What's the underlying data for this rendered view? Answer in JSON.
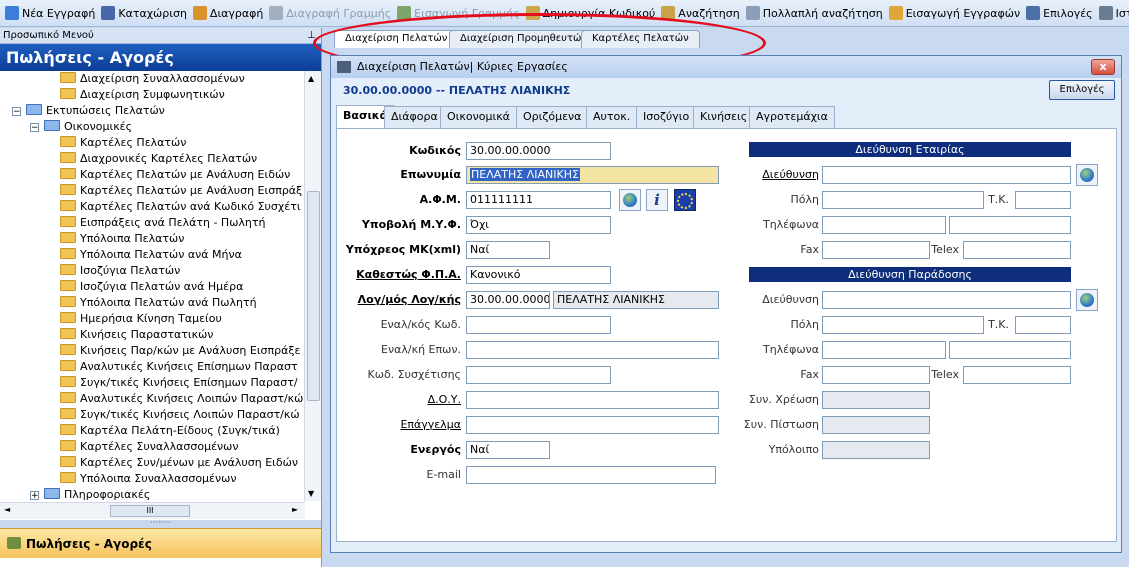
{
  "toolbar": {
    "items": [
      {
        "label": "Νέα Εγγραφή",
        "icon": "new-record-icon",
        "color": "#3b7dd8",
        "disabled": false
      },
      {
        "label": "Καταχώριση",
        "icon": "save-icon",
        "color": "#4867a8",
        "disabled": false
      },
      {
        "label": "Διαγραφή",
        "icon": "delete-icon",
        "color": "#d9922c",
        "disabled": false
      },
      {
        "label": "Διαγραφή Γραμμής",
        "icon": "delete-line-icon",
        "color": "#a3b0c2",
        "disabled": true
      },
      {
        "label": "Εισαγωγή Γραμμής",
        "icon": "insert-line-icon",
        "color": "#7fa66a",
        "disabled": true
      },
      {
        "label": "Δημιουργία Κωδικού",
        "icon": "create-code-icon",
        "color": "#c8a84a",
        "disabled": false
      },
      {
        "label": "Αναζήτηση",
        "icon": "search-icon",
        "color": "#c9a34a",
        "disabled": false
      },
      {
        "label": "Πολλαπλή αναζήτηση",
        "icon": "multi-search-icon",
        "color": "#8d9fb8",
        "disabled": false
      },
      {
        "label": "Εισαγωγή Εγγραφών",
        "icon": "import-records-icon",
        "color": "#e0a63a",
        "disabled": false
      },
      {
        "label": "Επιλογές",
        "icon": "options-icon",
        "color": "#4d6fa8",
        "disabled": false
      },
      {
        "label": "Ιστορικό",
        "icon": "history-icon",
        "color": "#6a7c93",
        "disabled": false
      }
    ]
  },
  "sidebar": {
    "caption": "Προσωπικό Μενού",
    "header": "Πωλήσεις - Αγορές",
    "tree": [
      {
        "label": "Διαχείριση Συναλλασσομένων",
        "level": 2,
        "blue": false,
        "toggle": ""
      },
      {
        "label": "Διαχείριση Συμφωνητικών",
        "level": 2,
        "blue": false,
        "toggle": ""
      },
      {
        "label": "Εκτυπώσεις Πελατών",
        "level": 0,
        "blue": true,
        "toggle": "−"
      },
      {
        "label": "Οικονομικές",
        "level": 1,
        "blue": true,
        "toggle": "−"
      },
      {
        "label": "Καρτέλες Πελατών",
        "level": 2,
        "blue": false,
        "toggle": ""
      },
      {
        "label": "Διαχρονικές Καρτέλες Πελατών",
        "level": 2,
        "blue": false,
        "toggle": ""
      },
      {
        "label": "Καρτέλες Πελατών με Ανάλυση Ειδών",
        "level": 2,
        "blue": false,
        "toggle": ""
      },
      {
        "label": "Καρτέλες Πελατών με Ανάλυση Εισπράξ",
        "level": 2,
        "blue": false,
        "toggle": ""
      },
      {
        "label": "Καρτέλες Πελατών ανά Κωδικό Συσχέτι",
        "level": 2,
        "blue": false,
        "toggle": ""
      },
      {
        "label": "Εισπράξεις ανά Πελάτη - Πωλητή",
        "level": 2,
        "blue": false,
        "toggle": ""
      },
      {
        "label": "Υπόλοιπα Πελατών",
        "level": 2,
        "blue": false,
        "toggle": ""
      },
      {
        "label": "Υπόλοιπα Πελατών ανά Μήνα",
        "level": 2,
        "blue": false,
        "toggle": ""
      },
      {
        "label": "Ισοζύγια Πελατών",
        "level": 2,
        "blue": false,
        "toggle": ""
      },
      {
        "label": "Ισοζύγια Πελατών ανά Ημέρα",
        "level": 2,
        "blue": false,
        "toggle": ""
      },
      {
        "label": "Υπόλοιπα Πελατών ανά Πωλητή",
        "level": 2,
        "blue": false,
        "toggle": ""
      },
      {
        "label": "Ημερήσια Κίνηση Ταμείου",
        "level": 2,
        "blue": false,
        "toggle": ""
      },
      {
        "label": "Κινήσεις Παραστατικών",
        "level": 2,
        "blue": false,
        "toggle": ""
      },
      {
        "label": "Κινήσεις Παρ/κών με Ανάλυση Εισπράξε",
        "level": 2,
        "blue": false,
        "toggle": ""
      },
      {
        "label": "Αναλυτικές Κινήσεις Επίσημων Παραστ",
        "level": 2,
        "blue": false,
        "toggle": ""
      },
      {
        "label": "Συγκ/τικές Κινήσεις Επίσημων Παραστ/",
        "level": 2,
        "blue": false,
        "toggle": ""
      },
      {
        "label": "Αναλυτικές Κινήσεις Λοιπών Παραστ/κώ",
        "level": 2,
        "blue": false,
        "toggle": ""
      },
      {
        "label": "Συγκ/τικές Κινήσεις Λοιπών Παραστ/κώ",
        "level": 2,
        "blue": false,
        "toggle": ""
      },
      {
        "label": "Καρτέλα Πελάτη-Είδους (Συγκ/τικά)",
        "level": 2,
        "blue": false,
        "toggle": ""
      },
      {
        "label": "Καρτέλες Συναλλασσομένων",
        "level": 2,
        "blue": false,
        "toggle": ""
      },
      {
        "label": "Καρτέλες Συν/μένων με Ανάλυση Ειδών",
        "level": 2,
        "blue": false,
        "toggle": ""
      },
      {
        "label": "Υπόλοιπα Συναλλασσομένων",
        "level": 2,
        "blue": false,
        "toggle": ""
      },
      {
        "label": "Πληροφοριακές",
        "level": 1,
        "blue": true,
        "toggle": "+"
      }
    ],
    "hscroll_thumb": "III",
    "footer": "Πωλήσεις - Αγορές"
  },
  "tabs": [
    "Διαχείριση Πελατών",
    "Διαχείριση Προμηθευτών",
    "Καρτέλες Πελατών"
  ],
  "window": {
    "title": "Διαχείριση Πελατών| Κύριες Εργασίες",
    "close": "x",
    "subtitle": "30.00.00.0000 -- ΠΕΛΑΤΗΣ ΛΙΑΝΙΚΗΣ",
    "options_button": "Επιλογές",
    "inner_tabs": [
      "Βασικά",
      "Διάφορα",
      "Οικονομικά",
      "Οριζόμενα",
      "Αυτοκ.",
      "Ισοζύγιο",
      "Κινήσεις",
      "Αγροτεμάχια"
    ]
  },
  "form": {
    "code_label": "Κωδικός",
    "code": "30.00.00.0000",
    "name_label": "Επωνυμία",
    "name": "ΠΕΛΑΤΗΣ ΛΙΑΝΙΚΗΣ",
    "afm_label": "Α.Φ.Μ.",
    "afm": "011111111",
    "myf_label": "Υποβολή Μ.Υ.Φ.",
    "myf": "Όχι",
    "mk_label": "Υπόχρεος ΜΚ(xml)",
    "mk": "Ναί",
    "vat_label": "Καθεστώς Φ.Π.Α.",
    "vat": "Κανονικό",
    "acct_label": "Λογ/μός Λογ/κής",
    "acct_code": "30.00.00.0000",
    "acct_name": "ΠΕΛΑΤΗΣ ΛΙΑΝΙΚΗΣ",
    "altcode_label": "Εναλ/κός Κωδ.",
    "altname_label": "Εναλ/κή Επων.",
    "relcode_label": "Κωδ. Συσχέτισης",
    "doy_label": "Δ.Ο.Υ.",
    "job_label": "Επάγγελμα",
    "active_label": "Ενεργός",
    "active": "Ναί",
    "email_label": "E-mail"
  },
  "company_address": {
    "title": "Διεύθυνση Εταιρίας",
    "address": "Διεύθυνση",
    "city": "Πόλη",
    "zip": "Τ.Κ.",
    "phones": "Τηλέφωνα",
    "fax": "Fax",
    "telex": "Telex"
  },
  "delivery_address": {
    "title": "Διεύθυνση Παράδοσης",
    "address": "Διεύθυνση",
    "city": "Πόλη",
    "zip": "Τ.Κ.",
    "phones": "Τηλέφωνα",
    "fax": "Fax",
    "telex": "Telex"
  },
  "balances": {
    "debit": "Συν. Χρέωση",
    "credit": "Συν. Πίστωση",
    "balance": "Υπόλοιπο"
  },
  "colors": {
    "header": "#0c3d95",
    "section": "#0e2d7a",
    "highlight": "#f4e4a4",
    "annotation": "#e30d1c"
  }
}
